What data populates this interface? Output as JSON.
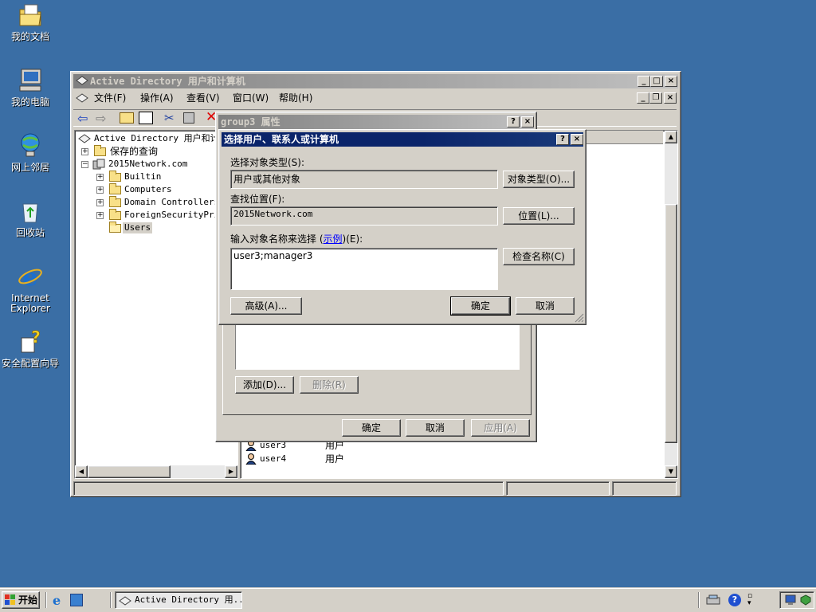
{
  "desktop": {
    "icons": [
      {
        "label": "我的文档",
        "icon": "my-documents-icon"
      },
      {
        "label": "我的电脑",
        "icon": "my-computer-icon"
      },
      {
        "label": "网上邻居",
        "icon": "network-places-icon"
      },
      {
        "label": "回收站",
        "icon": "recycle-bin-icon"
      },
      {
        "label": "Internet Explorer",
        "icon": "internet-explorer-icon"
      },
      {
        "label": "安全配置向导",
        "icon": "security-wizard-icon"
      }
    ]
  },
  "main_window": {
    "title": "Active Directory 用户和计算机",
    "menu": [
      "文件(F)",
      "操作(A)",
      "查看(V)",
      "窗口(W)",
      "帮助(H)"
    ],
    "tree": {
      "root": "Active Directory 用户和计",
      "saved_queries": "保存的查询",
      "domain": "2015Network.com",
      "children": [
        "Builtin",
        "Computers",
        "Domain Controllers",
        "ForeignSecurityPrin",
        "Users"
      ]
    },
    "list_rows": [
      {
        "name": "user3",
        "type": "用户"
      },
      {
        "name": "user4",
        "type": "用户"
      }
    ]
  },
  "props_dialog": {
    "title": "group3 属性",
    "help": "?",
    "close": "×",
    "add_button": "添加(D)...",
    "remove_button": "删除(R)",
    "ok_button": "确定",
    "cancel_button": "取消",
    "apply_button": "应用(A)"
  },
  "select_dialog": {
    "title": "选择用户、联系人或计算机",
    "help": "?",
    "close": "×",
    "object_type_label": "选择对象类型(S):",
    "object_type_value": "用户或其他对象",
    "object_type_button": "对象类型(O)...",
    "location_label": "查找位置(F):",
    "location_value": "2015Network.com",
    "location_button": "位置(L)...",
    "names_label_pre": "输入对象名称来选择 (",
    "names_label_link": "示例",
    "names_label_post": ")(E):",
    "names_value": "user3;manager3",
    "check_names_button": "检查名称(C)",
    "advanced_button": "高级(A)...",
    "ok_button": "确定",
    "cancel_button": "取消"
  },
  "taskbar": {
    "start": "开始",
    "task": "Active Directory 用..."
  },
  "colors": {
    "desktop": "#3a6ea5",
    "face": "#d4d0c8",
    "title_active": "#0a246a",
    "link": "#0000ff"
  }
}
